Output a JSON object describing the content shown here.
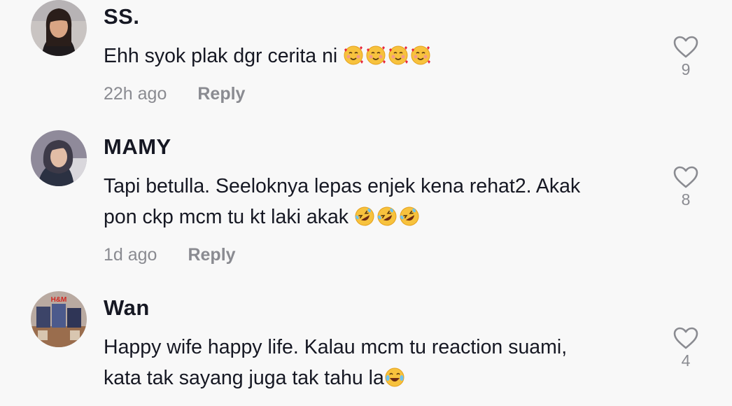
{
  "comments": [
    {
      "username": "SS.",
      "lines": [
        "Ehh syok plak dgr cerita ni"
      ],
      "emojis": [
        "smiling-face-with-hearts",
        "smiling-face-with-hearts",
        "smiling-face-with-hearts",
        "smiling-face-with-hearts"
      ],
      "time": "22h ago",
      "reply_label": "Reply",
      "likes": "9"
    },
    {
      "username": "MAMY",
      "lines": [
        "Tapi betulla. Seeloknya lepas enjek kena rehat2. Akak",
        "pon ckp mcm tu kt laki akak"
      ],
      "emojis": [
        "rolling-on-floor-laughing",
        "rolling-on-floor-laughing",
        "rolling-on-floor-laughing"
      ],
      "time": "1d ago",
      "reply_label": "Reply",
      "likes": "8"
    },
    {
      "username": "Wan",
      "lines": [
        "Happy wife happy life. Kalau mcm tu reaction suami,",
        "kata tak sayang juga tak tahu la"
      ],
      "emojis": [
        "face-with-tears-of-joy"
      ],
      "likes": "4",
      "avatar_sign_text": "H&M"
    }
  ],
  "colors": {
    "text": "#161823",
    "muted": "#8a8b91",
    "background": "#f8f8f8"
  }
}
